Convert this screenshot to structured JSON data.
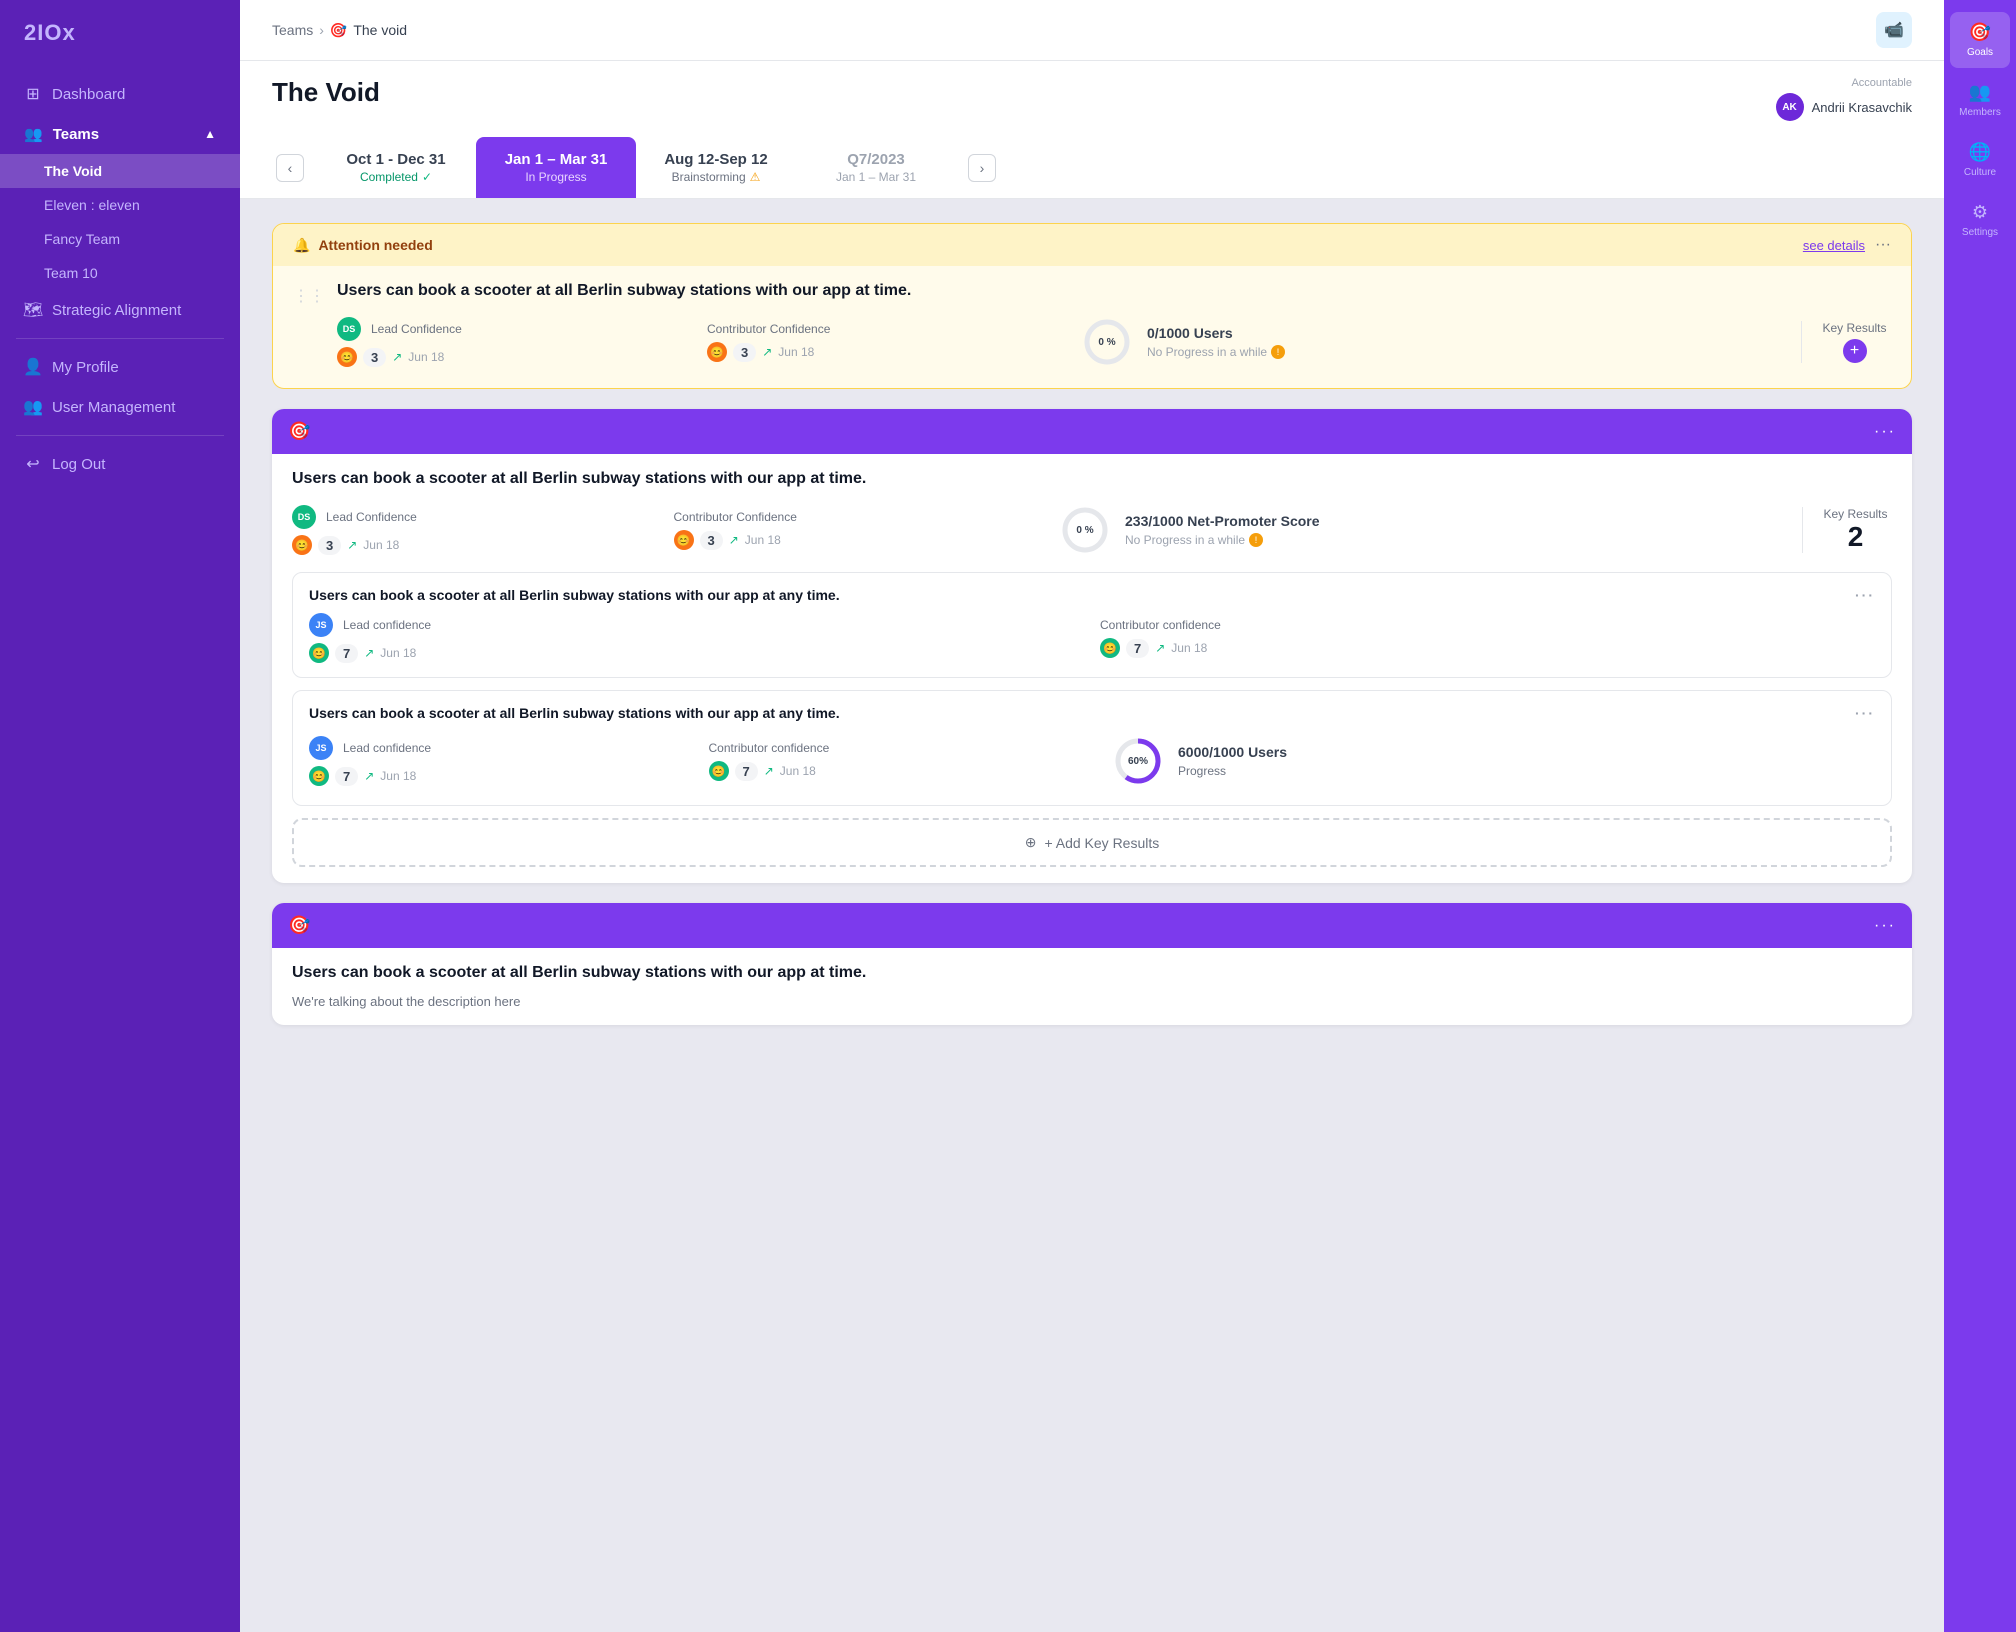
{
  "sidebar": {
    "logo": "2IOx",
    "items": [
      {
        "id": "dashboard",
        "label": "Dashboard",
        "icon": "⊞"
      },
      {
        "id": "teams",
        "label": "Teams",
        "icon": "👥",
        "expanded": true
      },
      {
        "id": "strategic",
        "label": "Strategic Alignment",
        "icon": "🗺"
      },
      {
        "id": "profile",
        "label": "My Profile",
        "icon": "👤"
      },
      {
        "id": "user-mgmt",
        "label": "User Management",
        "icon": "👥"
      },
      {
        "id": "logout",
        "label": "Log Out",
        "icon": "↩"
      }
    ],
    "teams": [
      {
        "id": "the-void",
        "label": "The Void",
        "active": true
      },
      {
        "id": "eleven",
        "label": "Eleven : eleven"
      },
      {
        "id": "fancy",
        "label": "Fancy Team"
      },
      {
        "id": "team10",
        "label": "Team 10"
      }
    ]
  },
  "breadcrumb": {
    "parent": "Teams",
    "separator": "›",
    "current_icon": "🎯",
    "current": "The void"
  },
  "header": {
    "title": "The Void",
    "accountable_label": "Accountable",
    "accountable_initials": "AK",
    "accountable_name": "Andrii Krasavchik"
  },
  "periods": [
    {
      "id": "oct-dec",
      "dates": "Oct 1 - Dec 31",
      "status": "Completed",
      "completed": true
    },
    {
      "id": "jan-mar",
      "dates": "Jan 1 – Mar 31",
      "status": "In Progress",
      "active": true
    },
    {
      "id": "aug-sep",
      "dates": "Aug 12-Sep 12",
      "status": "Brainstorming",
      "warn": true
    },
    {
      "id": "q7",
      "dates": "Q7/2023",
      "status": "Jan 1 – Mar 31",
      "gray": true
    }
  ],
  "right_sidebar": [
    {
      "id": "goals",
      "label": "Goals",
      "icon": "🎯",
      "active": true
    },
    {
      "id": "members",
      "label": "Members",
      "icon": "👥"
    },
    {
      "id": "culture",
      "label": "Culture",
      "icon": "🌐"
    },
    {
      "id": "settings",
      "label": "Settings",
      "icon": "⚙"
    }
  ],
  "attention": {
    "title": "Attention needed",
    "see_details": "see details",
    "goal": "Users can book a scooter at all Berlin subway stations with our app at  time.",
    "lead_label": "Lead Confidence",
    "lead_num": "3",
    "lead_date": "Jun 18",
    "contrib_label": "Contributor Confidence",
    "contrib_num": "3",
    "contrib_date": "Jun 18",
    "progress_pct": "0 %",
    "users_value": "0/1000 Users",
    "users_sub": "No Progress in a while",
    "key_results_label": "Key Results"
  },
  "goal_card_1": {
    "goal": "Users can book a scooter at all Berlin subway stations with our app at  time.",
    "lead_label": "Lead Confidence",
    "lead_num": "3",
    "lead_date": "Jun 18",
    "contrib_label": "Contributor Confidence",
    "contrib_num": "3",
    "contrib_date": "Jun 18",
    "progress_pct": "0 %",
    "metric_value": "233/1000 Net-Promoter Score",
    "users_sub": "No Progress in a while",
    "key_results_label": "Key Results",
    "key_results_num": "2",
    "sub_goals": [
      {
        "title": "Users can book a scooter at all Berlin subway stations with our app at any time.",
        "lead_label": "Lead confidence",
        "lead_num": "7",
        "lead_date": "Jun 18",
        "contrib_label": "Contributor confidence",
        "contrib_num": "7",
        "contrib_date": "Jun 18"
      },
      {
        "title": "Users can book a scooter at all Berlin subway stations with our app at any time.",
        "lead_label": "Lead confidence",
        "lead_num": "7",
        "lead_date": "Jun 18",
        "contrib_label": "Contributor confidence",
        "contrib_num": "7",
        "contrib_date": "Jun 18",
        "progress_pct": "60%",
        "metric_value": "6000/1000 Users",
        "metric_sub": "Progress"
      }
    ],
    "add_kr_label": "+ Add Key Results"
  },
  "goal_card_2": {
    "goal": "Users can book a scooter at all Berlin subway stations with our app at  time.",
    "description": "We're talking about the description here"
  }
}
